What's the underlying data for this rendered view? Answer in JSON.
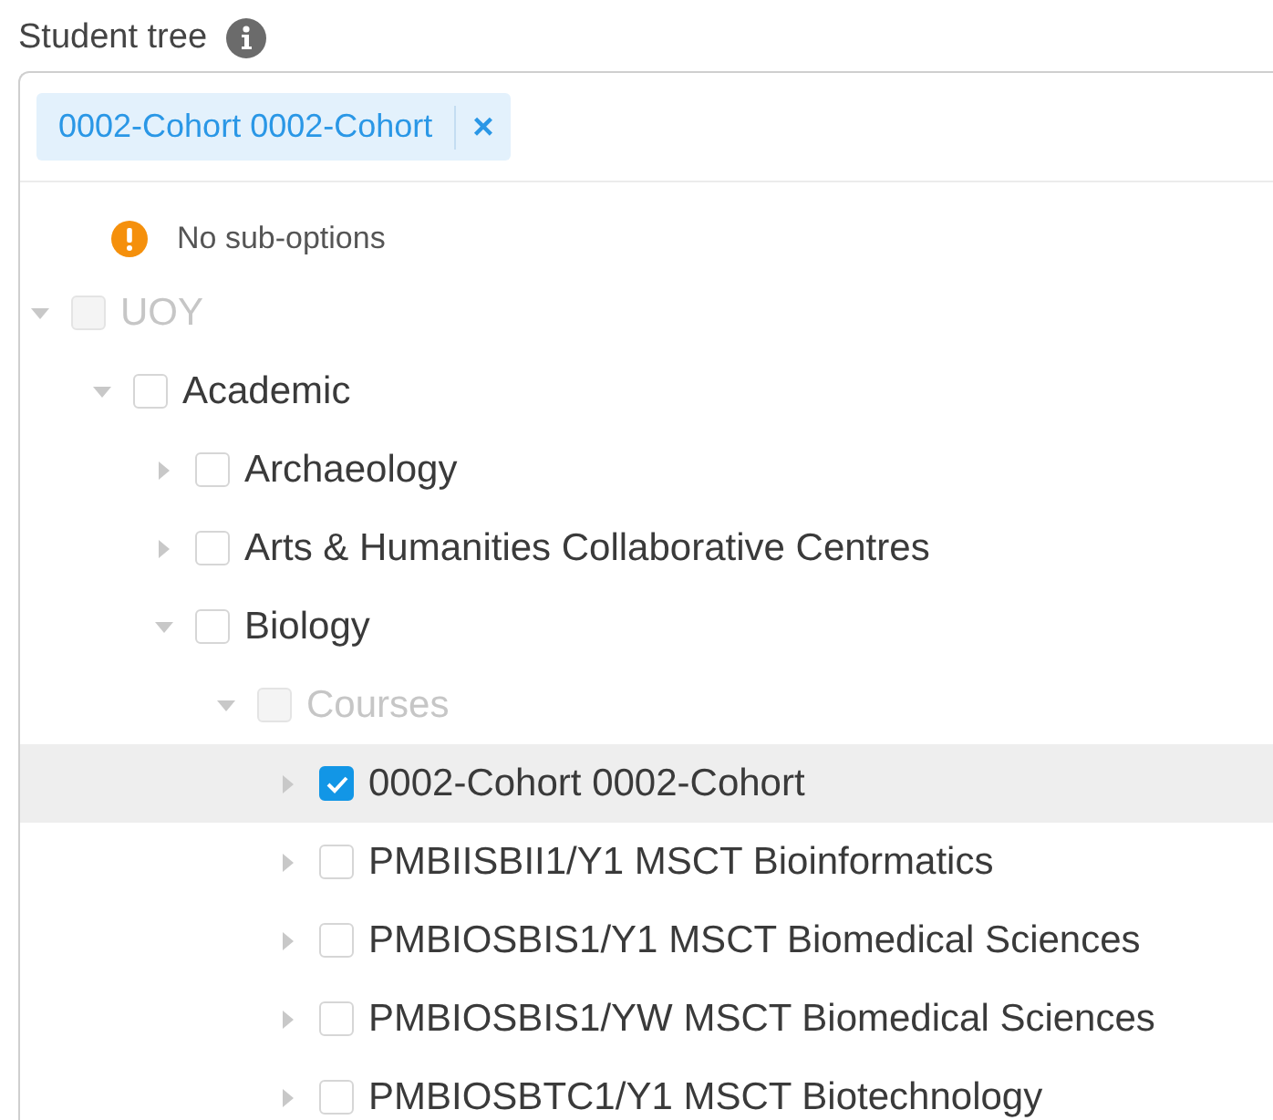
{
  "field": {
    "label": "Student tree",
    "tags": [
      {
        "label": "0002-Cohort 0002-Cohort",
        "remove": "×"
      }
    ]
  },
  "notice": "No sub-options",
  "tree": [
    {
      "label": "UOY",
      "expanded": true,
      "disabled": true,
      "checked": false,
      "highlighted": false,
      "children": [
        {
          "label": "Academic",
          "expanded": true,
          "disabled": false,
          "checked": false,
          "highlighted": false,
          "children": [
            {
              "label": "Archaeology",
              "expanded": false,
              "disabled": false,
              "checked": false,
              "highlighted": false
            },
            {
              "label": "Arts & Humanities Collaborative Centres",
              "expanded": false,
              "disabled": false,
              "checked": false,
              "highlighted": false
            },
            {
              "label": "Biology",
              "expanded": true,
              "disabled": false,
              "checked": false,
              "highlighted": false,
              "children": [
                {
                  "label": "Courses",
                  "expanded": true,
                  "disabled": true,
                  "checked": false,
                  "highlighted": false,
                  "children": [
                    {
                      "label": "0002-Cohort 0002-Cohort",
                      "expanded": false,
                      "disabled": false,
                      "checked": true,
                      "highlighted": true
                    },
                    {
                      "label": "PMBIISBII1/Y1 MSCT Bioinformatics",
                      "expanded": false,
                      "disabled": false,
                      "checked": false,
                      "highlighted": false
                    },
                    {
                      "label": "PMBIOSBIS1/Y1 MSCT Biomedical Sciences",
                      "expanded": false,
                      "disabled": false,
                      "checked": false,
                      "highlighted": false
                    },
                    {
                      "label": "PMBIOSBIS1/YW MSCT Biomedical Sciences",
                      "expanded": false,
                      "disabled": false,
                      "checked": false,
                      "highlighted": false
                    },
                    {
                      "label": "PMBIOSBTC1/Y1 MSCT Biotechnology",
                      "expanded": false,
                      "disabled": false,
                      "checked": false,
                      "highlighted": false
                    }
                  ]
                }
              ]
            }
          ]
        }
      ]
    }
  ]
}
